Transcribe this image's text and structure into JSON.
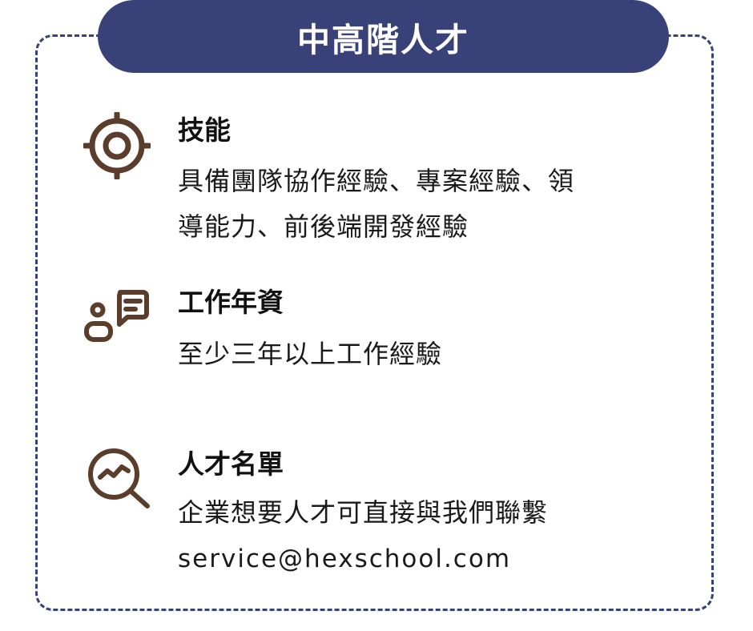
{
  "banner": {
    "title": "中高階人才"
  },
  "sections": [
    {
      "icon": "target-icon",
      "heading": "技能",
      "body_line1": "具備團隊協作經驗、專案經驗、領",
      "body_line2": "導能力、前後端開發經驗"
    },
    {
      "icon": "person-chat-icon",
      "heading": "工作年資",
      "body_line1": "至少三年以上工作經驗"
    },
    {
      "icon": "search-chart-icon",
      "heading": "人才名單",
      "body_line1": "企業想要人才可直接與我們聯繫",
      "email": "service@hexschool.com"
    }
  ],
  "colors": {
    "navy": "#384278",
    "brown": "#5a3d2b",
    "text": "#1a1a1a"
  }
}
